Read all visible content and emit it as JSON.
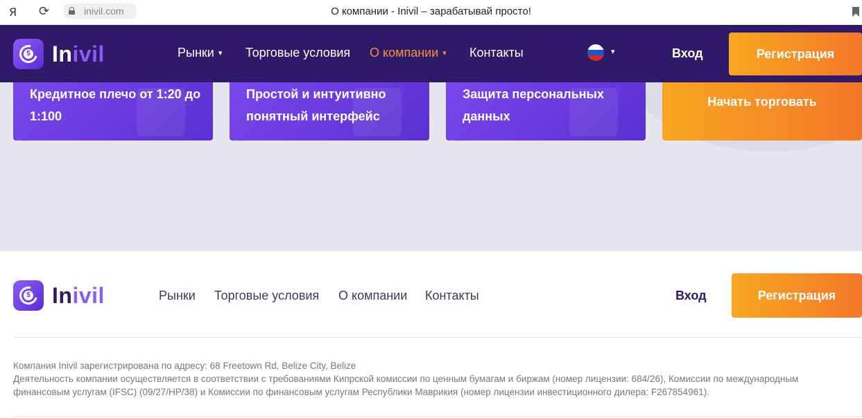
{
  "browser": {
    "yandex_glyph": "Я",
    "reload_glyph": "⟳",
    "url": "inivil.com",
    "title": "О компании - Inivil – зарабатывай просто!"
  },
  "brand": {
    "name_part1": "In",
    "name_part2": "ivil",
    "logo_symbol": "$",
    "colors": {
      "header_bg": "#2e1a69",
      "accent_purple": "#8b5cf6",
      "cta_orange": "#f47729",
      "active_nav": "#f5913e"
    }
  },
  "header": {
    "nav": [
      {
        "label": "Рынки",
        "has_dropdown": true
      },
      {
        "label": "Торговые условия",
        "has_dropdown": false
      },
      {
        "label": "О компании",
        "has_dropdown": true,
        "active": true
      },
      {
        "label": "Контакты",
        "has_dropdown": false
      }
    ],
    "caret": "▾",
    "language_flag": "russia-flag-icon",
    "login": "Вход",
    "register": "Регистрация"
  },
  "features": {
    "cards": [
      {
        "text": "Кредитное плечо от 1:20 до 1:100"
      },
      {
        "text": "Простой и интуитивно понятный интерфейс"
      },
      {
        "text": "Защита персональных данных"
      }
    ],
    "cta": "Начать торговать"
  },
  "footer": {
    "nav": [
      "Рынки",
      "Торговые условия",
      "О компании",
      "Контакты"
    ],
    "login": "Вход",
    "register": "Регистрация",
    "legal_line1": "Компания Inivil зарегистрирована по адресу: 68 Freetown Rd, Belize City, Belize",
    "legal_line2": "Деятельность компании осуществляется в соответствии с требованиями Кипрской комиссии по ценным бумагам и биржам (номер лицензии: 684/26), Комиссии по международным финансовым услугам (IFSC) (09/27/HP/38) и Комиссии по финансовым услугам Республики Маврикия (номер лицензии инвестиционного дилера: F267854961)."
  }
}
